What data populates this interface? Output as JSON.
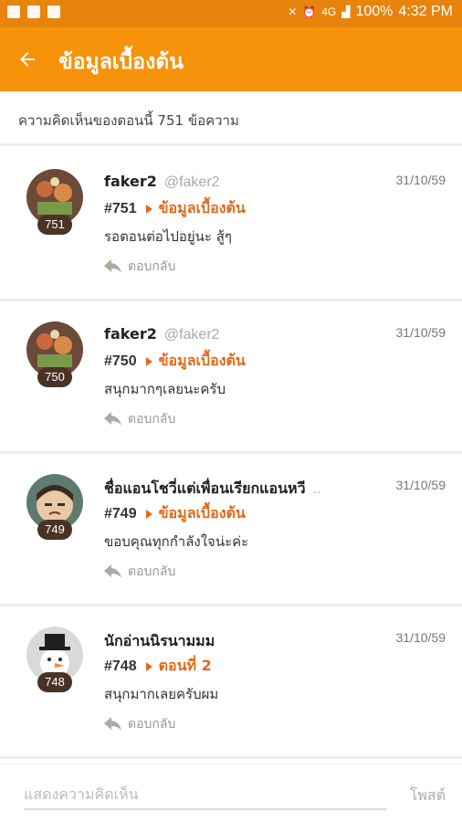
{
  "status_bar": {
    "battery": "100%",
    "time": "4:32 PM",
    "network": "4G"
  },
  "app_bar": {
    "title": "ข้อมูลเบื้องต้น"
  },
  "comment_count": "ความคิดเห็นของตอนนี้ 751 ข้อความ",
  "comments": [
    {
      "author": "faker2",
      "handle": "@faker2",
      "date": "31/10/59",
      "number": "#751",
      "ref": "ข้อมูลเบื้องต้น",
      "text": "รอตอนต่อไปอยู่นะ สู้ๆ",
      "reply": "ตอบกลับ",
      "badge": "751"
    },
    {
      "author": "faker2",
      "handle": "@faker2",
      "date": "31/10/59",
      "number": "#750",
      "ref": "ข้อมูลเบื้องต้น",
      "text": "สนุกมากๆเลยนะครับ",
      "reply": "ตอบกลับ",
      "badge": "750"
    },
    {
      "author": "ชื่อแอนโชวี่แต่เพื่อนเรียกแอนหวี",
      "handle": "..",
      "date": "31/10/59",
      "number": "#749",
      "ref": "ข้อมูลเบื้องต้น",
      "text": "ขอบคุณทุกกำลังใจน่ะค่ะ",
      "reply": "ตอบกลับ",
      "badge": "749"
    },
    {
      "author": "นักอ่านนิรนามมม",
      "handle": "",
      "date": "31/10/59",
      "number": "#748",
      "ref": "ตอนที่ 2",
      "text": "สนุกมากเลยครับผม",
      "reply": "ตอบกลับ",
      "badge": "748"
    }
  ],
  "input": {
    "placeholder": "แสดงความคิดเห็น",
    "post_label": "โพสต์"
  },
  "colors": {
    "accent": "#f7920b",
    "status_bar": "#e8830b",
    "link": "#e06a1a",
    "badge": "#4a3325"
  }
}
